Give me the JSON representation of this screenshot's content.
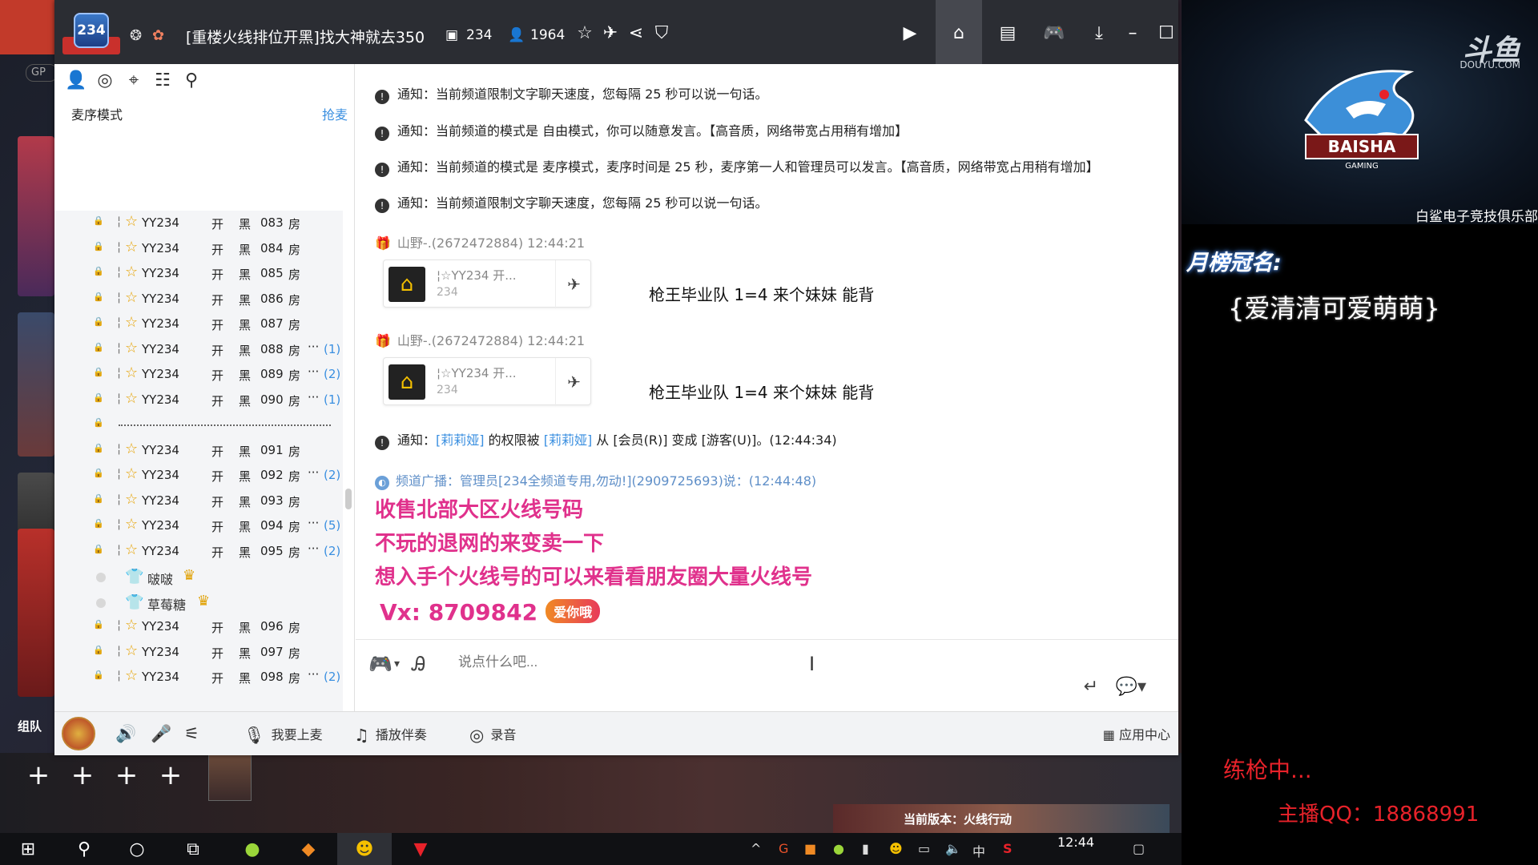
{
  "titlebar": {
    "channel_logo_text": "234",
    "title": "[重楼火线排位开黑]找大神就去350",
    "channel_number": "234",
    "online_count": "1964"
  },
  "left_panel": {
    "mode_label": "麦序模式",
    "grab_mic_label": "抢麦",
    "rows": [
      {
        "type": "room",
        "name": "YY234",
        "status": "开",
        "color": "黑",
        "num": "083",
        "room": "房",
        "more": "",
        "count": ""
      },
      {
        "type": "room",
        "name": "YY234",
        "status": "开",
        "color": "黑",
        "num": "084",
        "room": "房",
        "more": "",
        "count": ""
      },
      {
        "type": "room",
        "name": "YY234",
        "status": "开",
        "color": "黑",
        "num": "085",
        "room": "房",
        "more": "",
        "count": ""
      },
      {
        "type": "room",
        "name": "YY234",
        "status": "开",
        "color": "黑",
        "num": "086",
        "room": "房",
        "more": "",
        "count": ""
      },
      {
        "type": "room",
        "name": "YY234",
        "status": "开",
        "color": "黑",
        "num": "087",
        "room": "房",
        "more": "",
        "count": ""
      },
      {
        "type": "room",
        "name": "YY234",
        "status": "开",
        "color": "黑",
        "num": "088",
        "room": "房",
        "more": "···",
        "count": "(1)"
      },
      {
        "type": "room",
        "name": "YY234",
        "status": "开",
        "color": "黑",
        "num": "089",
        "room": "房",
        "more": "···",
        "count": "(2)"
      },
      {
        "type": "room",
        "name": "YY234",
        "status": "开",
        "color": "黑",
        "num": "090",
        "room": "房",
        "more": "···",
        "count": "(1)"
      },
      {
        "type": "sep"
      },
      {
        "type": "room",
        "name": "YY234",
        "status": "开",
        "color": "黑",
        "num": "091",
        "room": "房",
        "more": "",
        "count": ""
      },
      {
        "type": "room",
        "name": "YY234",
        "status": "开",
        "color": "黑",
        "num": "092",
        "room": "房",
        "more": "···",
        "count": "(2)"
      },
      {
        "type": "room",
        "name": "YY234",
        "status": "开",
        "color": "黑",
        "num": "093",
        "room": "房",
        "more": "",
        "count": ""
      },
      {
        "type": "room",
        "name": "YY234",
        "status": "开",
        "color": "黑",
        "num": "094",
        "room": "房",
        "more": "···",
        "count": "(5)"
      },
      {
        "type": "room",
        "name": "YY234",
        "status": "开",
        "color": "黑",
        "num": "095",
        "room": "房",
        "more": "···",
        "count": "(2)"
      },
      {
        "type": "member",
        "name": "啵啵"
      },
      {
        "type": "member",
        "name": "草莓糖"
      },
      {
        "type": "room",
        "name": "YY234",
        "status": "开",
        "color": "黑",
        "num": "096",
        "room": "房",
        "more": "",
        "count": ""
      },
      {
        "type": "room",
        "name": "YY234",
        "status": "开",
        "color": "黑",
        "num": "097",
        "room": "房",
        "more": "",
        "count": ""
      },
      {
        "type": "room",
        "name": "YY234",
        "status": "开",
        "color": "黑",
        "num": "098",
        "room": "房",
        "more": "···",
        "count": "(2)"
      }
    ]
  },
  "chat": {
    "notice_label": "通知：",
    "notices": [
      "当前频道限制文字聊天速度，您每隔 25 秒可以说一句话。",
      "当前频道的模式是 自由模式，你可以随意发言。【高音质，网络带宽占用稍有增加】",
      "当前频道的模式是 麦序模式，麦序时间是 25 秒，麦序第一人和管理员可以发言。【高音质，网络带宽占用稍有增加】",
      "当前频道限制文字聊天速度，您每隔 25 秒可以说一句话。"
    ],
    "messages": [
      {
        "sender": "山野-.(2672472884)",
        "time": "12:44:21",
        "card_title": "YY234",
        "card_suffix": "开...",
        "card_sub": "234",
        "text": "枪王毕业队  1=4  来个妹妹  能背"
      },
      {
        "sender": "山野-.(2672472884)",
        "time": "12:44:21",
        "card_title": "YY234",
        "card_suffix": "开...",
        "card_sub": "234",
        "text": "枪王毕业队  1=4  来个妹妹  能背"
      }
    ],
    "perm_notice": {
      "user1": "[莉莉娅]",
      "mid1": " 的权限被 ",
      "user2": "[莉莉娅]",
      "mid2": " 从 [会员(R)] 变成 [游客(U)]。(12:44:34)"
    },
    "broadcast": "频道广播：管理员[234全频道专用,勿动!](2909725693)说：(12:44:48)",
    "pink_lines": [
      "收售北部大区火线号码",
      "不玩的退网的来变卖一下",
      "想入手个火线号的可以来看看朋友圈大量火线号"
    ],
    "vx_label": "Vx:",
    "vx_number": "8709842",
    "vx_badge": "爱你哦"
  },
  "input": {
    "placeholder": "说点什么吧..."
  },
  "toolbar": {
    "mic_up": "我要上麦",
    "play_music": "播放伴奏",
    "record": "录音",
    "apps": "应用中心"
  },
  "overlay": {
    "douyu": "斗鱼",
    "douyu_sub": "DOUYU.COM",
    "club": "白鲨电子竞技俱乐部",
    "shark_text": "BAISHA",
    "shark_sub": "GAMING",
    "champ_label": "月榜冠名:",
    "champ_name": "{爱清清可爱萌萌}",
    "practice": "练枪中...",
    "qq": "主播QQ：18868991"
  },
  "background": {
    "gp": "GP",
    "team_label": "组队",
    "version": "当前版本：火线行动"
  },
  "taskbar": {
    "time": "12:44",
    "ime": "中"
  },
  "colors": {
    "accent_blue": "#3a8fe0",
    "pink_text": "#e0318c",
    "red_overlay": "#e8222a",
    "titlebar_bg": "#2b2d33"
  }
}
